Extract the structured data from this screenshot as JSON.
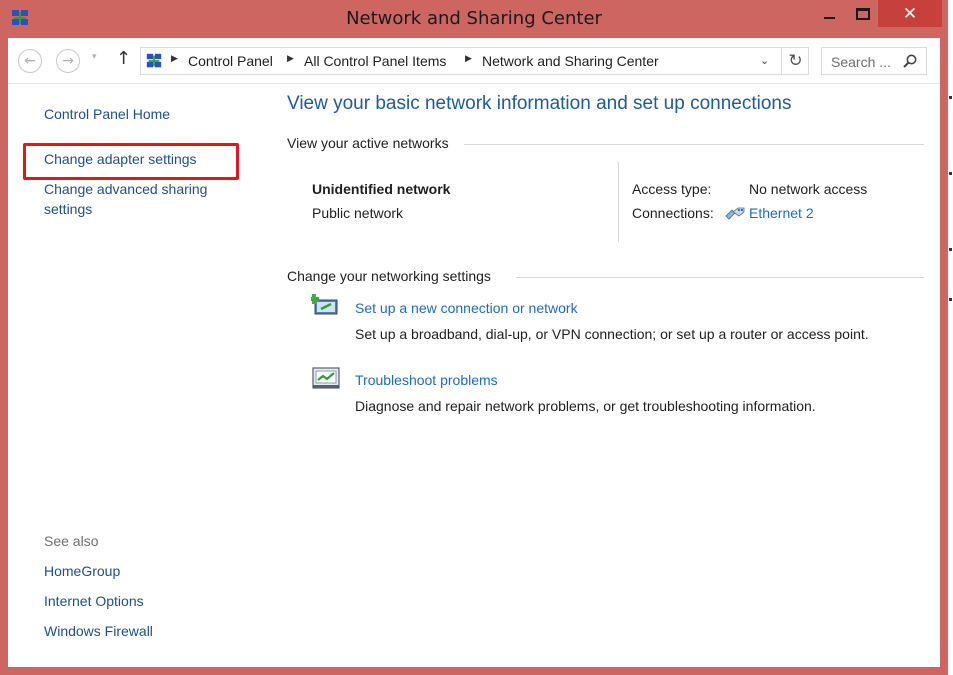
{
  "window": {
    "title": "Network and Sharing Center",
    "close_glyph": "✕",
    "frame_color": "#cd6660",
    "close_color": "#c7413c"
  },
  "nav": {
    "back_glyph": "←",
    "forward_glyph": "→",
    "history_glyph": "▾",
    "up_glyph": "↑",
    "breadcrumbs": [
      "Control Panel",
      "All Control Panel Items",
      "Network and Sharing Center"
    ],
    "separator_glyph": "▶",
    "dropdown_glyph": "⌄",
    "refresh_glyph": "↻",
    "search_placeholder": "Search ..."
  },
  "sidebar": {
    "home": "Control Panel Home",
    "adapter": "Change adapter settings",
    "advanced_line1": "Change advanced sharing",
    "advanced_line2": "settings",
    "see_also_label": "See also",
    "see_also": [
      "HomeGroup",
      "Internet Options",
      "Windows Firewall"
    ],
    "highlight_color": "#e8141c"
  },
  "main": {
    "heading": "View your basic network information and set up connections",
    "active_networks_title": "View your active networks",
    "network_name": "Unidentified network",
    "network_category": "Public network",
    "access_type_label": "Access type:",
    "access_type_value": "No network access",
    "connections_label": "Connections:",
    "connection_name": "Ethernet 2",
    "change_settings_title": "Change your networking settings",
    "tasks": [
      {
        "link": "Set up a new connection or network",
        "description": "Set up a broadband, dial-up, or VPN connection; or set up a router or access point."
      },
      {
        "link": "Troubleshoot problems",
        "description": "Diagnose and repair network problems, or get troubleshooting information."
      }
    ],
    "link_color": "#1e6ac8",
    "heading_color": "#1e5aa0"
  }
}
